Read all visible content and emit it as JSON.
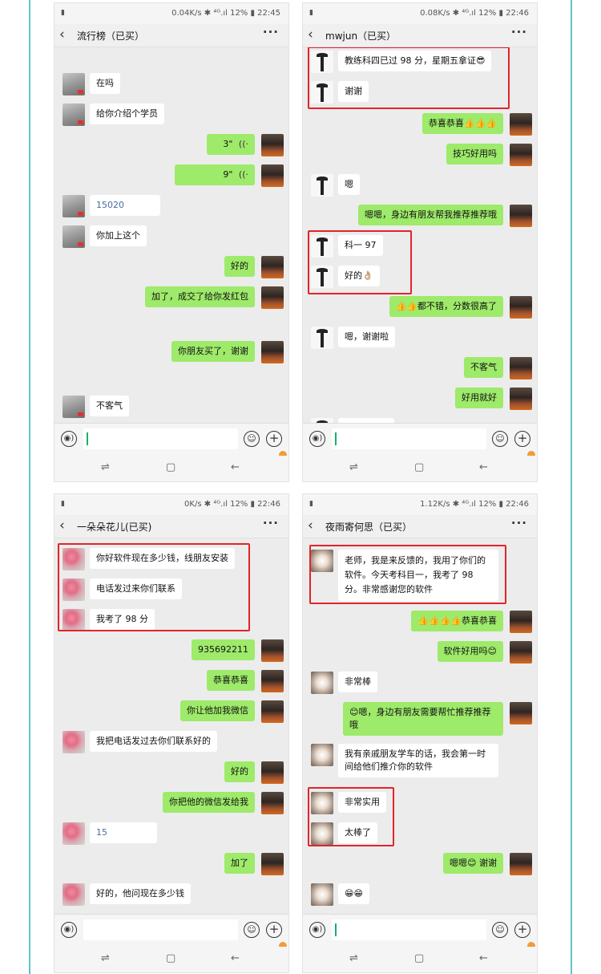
{
  "screens": [
    {
      "status": {
        "left": "▮",
        "right": "0.04K/s ✱ ⁴ᴳ.ıl 12% ▮ 22:45"
      },
      "title": "流行榜（已买）",
      "messages": [
        {
          "side": "left",
          "avatar": "gray",
          "text": "在吗"
        },
        {
          "side": "left",
          "avatar": "gray",
          "text": "给你介绍个学员"
        },
        {
          "side": "right",
          "avatar": "car",
          "text": "3\"",
          "voice": "((·"
        },
        {
          "side": "right",
          "avatar": "car",
          "text": "9\"",
          "voice": "((·"
        },
        {
          "side": "left",
          "avatar": "gray",
          "text": "15020"
        },
        {
          "side": "left",
          "avatar": "gray",
          "text": "你加上这个"
        },
        {
          "side": "right",
          "avatar": "car",
          "text": "好的"
        },
        {
          "side": "right",
          "avatar": "car",
          "text": "加了，成交了给你发红包"
        },
        {
          "side": "right",
          "avatar": "car",
          "text": "你朋友买了，谢谢"
        },
        {
          "side": "left",
          "avatar": "gray",
          "text": "不客气"
        }
      ]
    },
    {
      "status": {
        "left": "▮",
        "right": "0.08K/s ✱ ⁴ᴳ.ıl 12% ▮ 22:46"
      },
      "title": "mwjun（已买）",
      "messages": [
        {
          "side": "left",
          "avatar": "person",
          "text": "教练科四已过 98 分，星期五拿证😎"
        },
        {
          "side": "left",
          "avatar": "person",
          "text": "谢谢"
        },
        {
          "side": "right",
          "avatar": "car",
          "text": "恭喜恭喜👍👍👍"
        },
        {
          "side": "right",
          "avatar": "car",
          "text": "技巧好用吗"
        },
        {
          "side": "left",
          "avatar": "person",
          "text": "嗯"
        },
        {
          "side": "right",
          "avatar": "car",
          "text": "嗯嗯，身边有朋友帮我推荐推荐哦"
        },
        {
          "side": "left",
          "avatar": "person",
          "text": "科一 97"
        },
        {
          "side": "left",
          "avatar": "person",
          "text": "好的👌🏼"
        },
        {
          "side": "right",
          "avatar": "car",
          "text": "👍👍都不错，分数很高了"
        },
        {
          "side": "left",
          "avatar": "person",
          "text": "嗯，谢谢啦"
        },
        {
          "side": "right",
          "avatar": "car",
          "text": "不客气"
        },
        {
          "side": "right",
          "avatar": "car",
          "text": "好用就好"
        }
      ]
    },
    {
      "status": {
        "left": "▮",
        "right": "0K/s ✱ ⁴ᴳ.ıl 12% ▮ 22:46"
      },
      "title": "一朵朵花儿(已买)",
      "messages": [
        {
          "side": "left",
          "avatar": "flower",
          "text": "你好软件现在多少钱，线朋友安装"
        },
        {
          "side": "left",
          "avatar": "flower",
          "text": "电话发过来你们联系"
        },
        {
          "side": "left",
          "avatar": "flower",
          "text": "我考了 98 分"
        },
        {
          "side": "right",
          "avatar": "car",
          "text": "935692211"
        },
        {
          "side": "right",
          "avatar": "car",
          "text": "恭喜恭喜"
        },
        {
          "side": "right",
          "avatar": "car",
          "text": "你让他加我微信"
        },
        {
          "side": "left",
          "avatar": "flower",
          "text": "我把电话发过去你们联系好的"
        },
        {
          "side": "right",
          "avatar": "car",
          "text": "好的"
        },
        {
          "side": "right",
          "avatar": "car",
          "text": "你把他的微信发给我"
        },
        {
          "side": "left",
          "avatar": "flower",
          "text": "15"
        },
        {
          "side": "right",
          "avatar": "car",
          "text": "加了"
        },
        {
          "side": "left",
          "avatar": "flower",
          "text": "好的，他问现在多少钱"
        }
      ]
    },
    {
      "status": {
        "left": "▮",
        "right": "1.12K/s ✱ ⁴ᴳ.ıl 12% ▮ 22:46"
      },
      "title": "夜雨寄何思（已买）",
      "messages": [
        {
          "side": "left",
          "avatar": "cat",
          "text": "老师，我是来反馈的，我用了你们的软件。今天考科目一，我考了 98 分。非常感谢您的软件"
        },
        {
          "side": "right",
          "avatar": "car",
          "text": "👍👍👍👍恭喜恭喜"
        },
        {
          "side": "right",
          "avatar": "car",
          "text": "软件好用吗😊"
        },
        {
          "side": "left",
          "avatar": "cat",
          "text": "非常棒"
        },
        {
          "side": "right",
          "avatar": "car",
          "text": "😊嗯，身边有朋友需要帮忙推荐推荐哦"
        },
        {
          "side": "left",
          "avatar": "cat",
          "text": "我有亲戚朋友学车的话，我会第一时间给他们推介你的软件"
        },
        {
          "side": "left",
          "avatar": "cat",
          "text": "非常实用"
        },
        {
          "side": "left",
          "avatar": "cat",
          "text": "太棒了"
        },
        {
          "side": "right",
          "avatar": "car",
          "text": "嗯嗯😊 谢谢"
        },
        {
          "side": "left",
          "avatar": "cat",
          "text": "😁😁"
        }
      ]
    }
  ],
  "icons": {
    "back": "‹",
    "more": "···",
    "voice": "◉)",
    "emoji": "☺",
    "plus": "+",
    "nav_recent": "⇌",
    "nav_home": "▢",
    "nav_back": "←"
  },
  "colors": {
    "frame_line": "#5fc4c4",
    "sent_bubble": "#9eea6a",
    "received_bubble": "#ffffff",
    "chat_background": "#ececec",
    "highlight_border": "#e2242a"
  }
}
